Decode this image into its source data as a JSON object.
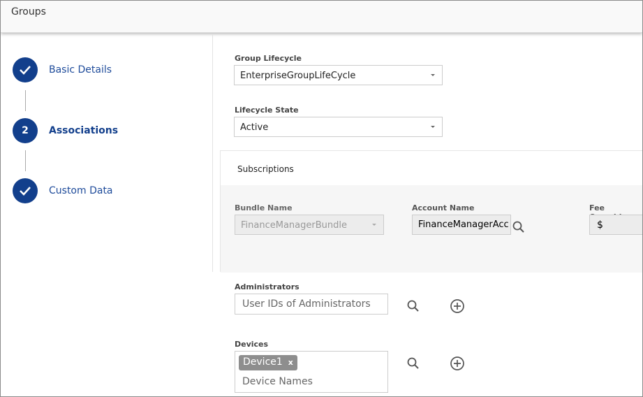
{
  "header": {
    "title": "Groups"
  },
  "steps": [
    {
      "label": "Basic Details",
      "state": "done",
      "icon": "check-icon"
    },
    {
      "label": "Associations",
      "state": "active",
      "number": "2"
    },
    {
      "label": "Custom Data",
      "state": "done",
      "icon": "check-icon"
    }
  ],
  "form": {
    "group_lifecycle": {
      "label": "Group Lifecycle",
      "value": "EnterpriseGroupLifeCycle"
    },
    "lifecycle_state": {
      "label": "Lifecycle State",
      "value": "Active"
    },
    "subscriptions": {
      "title": "Subscriptions",
      "bundle_name": {
        "label": "Bundle Name",
        "value": "FinanceManagerBundle"
      },
      "account_name": {
        "label": "Account Name",
        "value": "FinanceManagerAcc"
      },
      "fee_override": {
        "label": "Fee Override",
        "value": "$"
      }
    },
    "administrators": {
      "label": "Administrators",
      "placeholder": "User IDs of Administrators"
    },
    "devices": {
      "label": "Devices",
      "tags": [
        "Device1"
      ],
      "tag_remove": "x",
      "placeholder": "Device Names"
    }
  },
  "colors": {
    "primary": "#123f8c",
    "link": "#1d4a9a"
  }
}
